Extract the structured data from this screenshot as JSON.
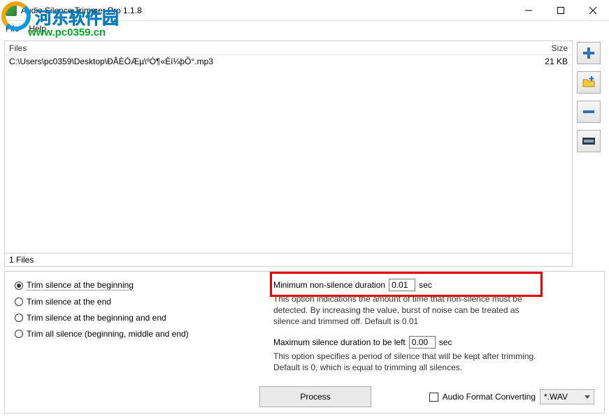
{
  "window": {
    "title": "Audio Silence Trimmer Pro 1.1.8"
  },
  "menu": {
    "file": "File",
    "help": "Help"
  },
  "watermark": {
    "brand": "河东软件园",
    "url": "www.pc0359.cn"
  },
  "file_table": {
    "head_files": "Files",
    "head_size": "Size",
    "rows": [
      {
        "path": "C:\\Users\\pc0359\\Desktop\\ÐÂÈÓÆµ\\ºÓ¶«Èí¼þÔ°.mp3",
        "size": "21 KB"
      }
    ],
    "count_label": "1 Files"
  },
  "radios": {
    "opt1": "Trim silence at the beginning",
    "opt2": "Trim silence at the end",
    "opt3": "Trim silence at the beginning and end",
    "opt4": "Trim all silence (beginning, middle and end)"
  },
  "min_ns": {
    "label": "Minimum non-silence duration",
    "value": "0.01",
    "unit": "sec",
    "desc": "This option indications the amount of time that non-silence must be detected. By increasing the value, burst of noise can be treated as silence and trimmed off. Default is 0.01"
  },
  "max_sil": {
    "label": "Maximum silence duration to be left",
    "value": "0.00",
    "unit": "sec",
    "desc": "This option specifies a period of silence that will be kept after trimming. Default is 0, which is equal to trimming all silences."
  },
  "process_label": "Process",
  "afc_label": "Audio Format Converting",
  "format_selected": "*.WAV"
}
